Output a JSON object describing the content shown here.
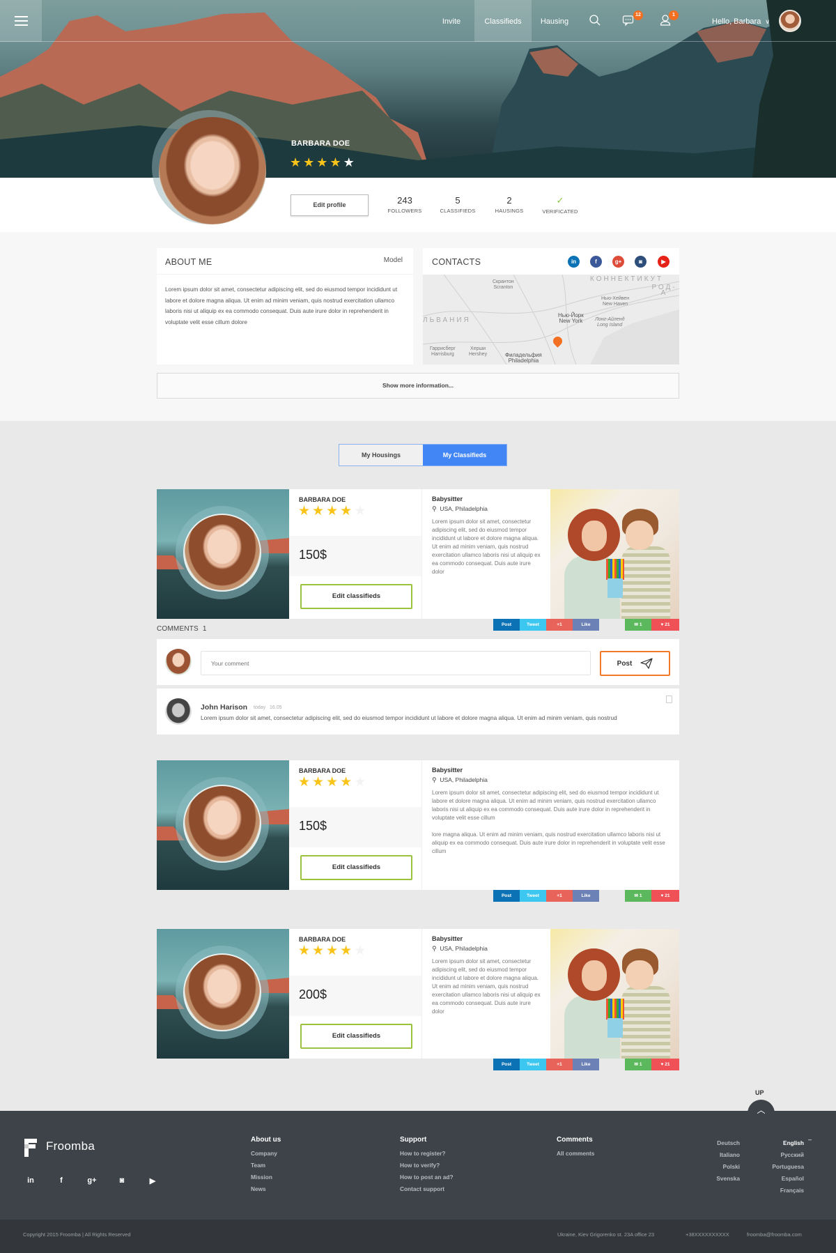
{
  "nav": {
    "links": [
      "Invite",
      "Classifieds",
      "Hausing"
    ],
    "active": "Classifieds",
    "messages_badge": "12",
    "notifications_badge": "1",
    "greeting": "Hello, Barbara"
  },
  "profile": {
    "name": "BARBARA DOE",
    "rating": 4,
    "rating_max": 5,
    "edit_label": "Edit profile",
    "stats": [
      {
        "value": "243",
        "label": "FOLLOWERS"
      },
      {
        "value": "5",
        "label": "CLASSIFIEDS"
      },
      {
        "value": "2",
        "label": "HAUSINGS"
      },
      {
        "value": "✓",
        "label": "VERIFICATED"
      }
    ]
  },
  "about": {
    "title": "ABOUT ME",
    "role": "Model",
    "text": "Lorem ipsum dolor sit amet, consectetur adipiscing elit, sed do eiusmod tempor incididunt ut labore et dolore magna aliqua. Ut enim ad minim veniam, quis nostrud exercitation ullamco laboris nisi ut aliquip ex ea commodo consequat. Duis aute irure dolor in reprehenderit in voluptate velit esse cillum dolore"
  },
  "contacts": {
    "title": "CONTACTS",
    "socials": [
      {
        "name": "linkedin",
        "glyph": "in",
        "color": "#0b72b5"
      },
      {
        "name": "facebook",
        "glyph": "f",
        "color": "#3b5998"
      },
      {
        "name": "google-plus",
        "glyph": "g+",
        "color": "#dd4b39"
      },
      {
        "name": "instagram",
        "glyph": "◙",
        "color": "#2e4f7c"
      },
      {
        "name": "youtube",
        "glyph": "▶",
        "color": "#e62117"
      }
    ],
    "map_labels": [
      {
        "text": "Скрантон\nScranton"
      },
      {
        "text": "КОННЕКТИКУТ"
      },
      {
        "text": "РОД-А"
      },
      {
        "text": "Нью-Хейвен\nNew Haven"
      },
      {
        "text": "ЛЬВАНИЯ"
      },
      {
        "text": "Нью-Йорк\nNew York"
      },
      {
        "text": "Лонг-Айленд\nLong Island"
      },
      {
        "text": "Гаррисберг\nHarrisburg"
      },
      {
        "text": "Херши\nHershey"
      },
      {
        "text": "Филадельфия\nPhiladelphia"
      }
    ]
  },
  "show_more": "Show more information...",
  "tabs": [
    {
      "label": "My Housings",
      "active": false
    },
    {
      "label": "My Classifieds",
      "active": true
    }
  ],
  "classifieds": [
    {
      "owner": "BARBARA DOE",
      "rating": 4,
      "price": "150$",
      "edit_label": "Edit classifieds",
      "title": "Babysitter",
      "location": "USA, Philadelphia",
      "description": "Lorem ipsum dolor sit amet, consectetur adipiscing elit, sed do eiusmod tempor incididunt ut labore et dolore magna aliqua. Ut enim ad minim veniam, quis nostrud exercitation ullamco laboris nisi ut aliquip ex ea commodo consequat. Duis aute irure dolor",
      "description_2": "",
      "has_image": true,
      "comments_count": "1",
      "likes_count": "21"
    },
    {
      "owner": "BARBARA DOE",
      "rating": 4,
      "price": "150$",
      "edit_label": "Edit classifieds",
      "title": "Babysitter",
      "location": "USA, Philadelphia",
      "description": "Lorem ipsum dolor sit amet, consectetur adipiscing elit, sed do eiusmod tempor incididunt ut labore et dolore magna aliqua. Ut enim ad minim veniam, quis nostrud exercitation ullamco laboris nisi ut aliquip ex ea commodo consequat. Duis aute irure dolor in reprehenderit in voluptate velit esse cillum",
      "description_2": "lore magna aliqua. Ut enim ad minim veniam, quis nostrud exercitation ullamco laboris nisi ut aliquip ex ea commodo consequat. Duis aute irure dolor in reprehenderit in voluptate velit esse cillum",
      "has_image": false,
      "comments_count": "1",
      "likes_count": "21"
    },
    {
      "owner": "BARBARA DOE",
      "rating": 4,
      "price": "200$",
      "edit_label": "Edit classifieds",
      "title": "Babysitter",
      "location": "USA, Philadelphia",
      "description": "Lorem ipsum dolor sit amet, consectetur adipiscing elit, sed do eiusmod tempor incididunt ut labore et dolore magna aliqua. Ut enim ad minim veniam, quis nostrud exercitation ullamco laboris nisi ut aliquip ex ea commodo consequat. Duis aute irure dolor",
      "description_2": "",
      "has_image": true,
      "comments_count": "1",
      "likes_count": "21"
    }
  ],
  "share": {
    "post": "Post",
    "tweet": "Tweet",
    "plus": "+1",
    "like": "Like"
  },
  "comments": {
    "label": "COMMENTS",
    "count": "1",
    "placeholder": "Your comment",
    "post_label": "Post",
    "items": [
      {
        "author": "John Harison",
        "day": "today",
        "time": "16.05",
        "text": "Lorem ipsum dolor sit amet, consectetur adipiscing elit, sed do eiusmod tempor incididunt ut labore et dolore magna aliqua. Ut enim ad minim veniam, quis nostrud"
      }
    ]
  },
  "up_label": "UP",
  "footer": {
    "brand": "Froomba",
    "socials": [
      "in",
      "f",
      "g+",
      "◙",
      "▶"
    ],
    "columns": [
      {
        "title": "About us",
        "links": [
          "Company",
          "Team",
          "Mission",
          "News"
        ]
      },
      {
        "title": "Support",
        "links": [
          "How to register?",
          "How to verify?",
          "How to post an ad?",
          "Contact  support"
        ]
      },
      {
        "title": "Comments",
        "links": [
          "All comments"
        ]
      }
    ],
    "languages_left": [
      "Deutsch",
      "Italiano",
      "Polski",
      "Svenska"
    ],
    "languages_right": [
      "English",
      "Русский",
      "Portuguesa",
      "Español",
      "Français"
    ],
    "active_language": "English",
    "copyright": "Copyright 2015 Froomba | All Rights Reserved",
    "address": "Ukraine, Kiev Grigorenko st. 23A office 23",
    "phone": "+38XXXXXXXXXX",
    "email": "froomba@froomba.com"
  },
  "colors": {
    "accent_blue": "#4286f5",
    "badge_orange": "#f36f21",
    "star_yellow": "#f8c41a",
    "edit_green": "#9ac23c",
    "post_orange": "#f07a2c",
    "footer_bg": "#3d4349"
  }
}
